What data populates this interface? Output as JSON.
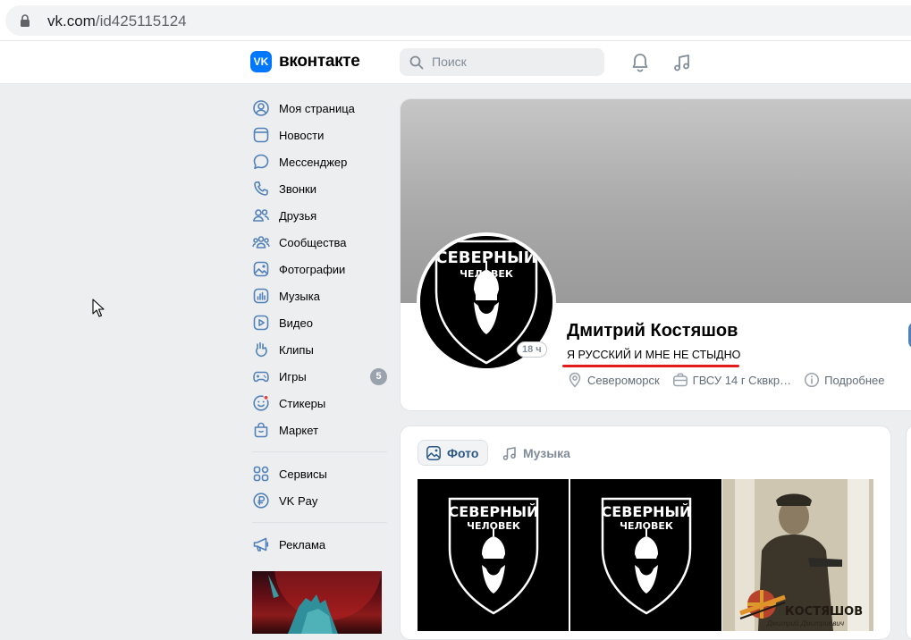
{
  "browser": {
    "url_host": "vk.com",
    "url_path": "/id425115124"
  },
  "header": {
    "logo_text": "вконтакте",
    "logo_mark": "VK",
    "search_placeholder": "Поиск",
    "icons": [
      "bell-icon",
      "music-icon"
    ]
  },
  "nav": {
    "items": [
      {
        "label": "Моя страница",
        "icon": "user-circle-icon"
      },
      {
        "label": "Новости",
        "icon": "news-icon"
      },
      {
        "label": "Мессенджер",
        "icon": "chat-icon"
      },
      {
        "label": "Звонки",
        "icon": "phone-icon"
      },
      {
        "label": "Друзья",
        "icon": "friends-icon"
      },
      {
        "label": "Сообщества",
        "icon": "communities-icon"
      },
      {
        "label": "Фотографии",
        "icon": "photo-icon"
      },
      {
        "label": "Музыка",
        "icon": "music-icon"
      },
      {
        "label": "Видео",
        "icon": "video-icon"
      },
      {
        "label": "Клипы",
        "icon": "clips-icon"
      },
      {
        "label": "Игры",
        "icon": "games-icon",
        "badge": "5"
      },
      {
        "label": "Стикеры",
        "icon": "stickers-icon"
      },
      {
        "label": "Маркет",
        "icon": "market-icon"
      }
    ],
    "secondary": [
      {
        "label": "Сервисы",
        "icon": "services-icon"
      },
      {
        "label": "VK Pay",
        "icon": "vkpay-icon"
      }
    ],
    "ads": {
      "label": "Реклама",
      "icon": "megaphone-icon"
    }
  },
  "profile": {
    "name": "Дмитрий Костяшов",
    "status": "Я РУССКИЙ И МНЕ НЕ СТЫДНО",
    "online": "18 ч",
    "avatar_text_top": "СЕВЕРНЫЙ",
    "avatar_text_bottom": "ЧЕЛОВЕК",
    "city": "Североморск",
    "work": "ГВСУ 14 г Сквкр…",
    "more": "Подробнее"
  },
  "media": {
    "tabs": [
      {
        "label": "Фото",
        "active": true
      },
      {
        "label": "Музыка",
        "active": false
      }
    ],
    "photos": [
      {
        "kind": "emblem",
        "line1": "СЕВЕРНЫЙ",
        "line2": "ЧЕЛОВЕК"
      },
      {
        "kind": "emblem",
        "line1": "СЕВЕРНЫЙ",
        "line2": "ЧЕЛОВЕК"
      },
      {
        "kind": "portrait",
        "caption": "КОСТЯШОВ",
        "subcaption": "Дмитрий Дмитриевич"
      }
    ]
  },
  "colors": {
    "vk_blue": "#0077ff",
    "link": "#2a5885",
    "status_underline": "#e41b1b",
    "badge": "#99a2ad"
  }
}
